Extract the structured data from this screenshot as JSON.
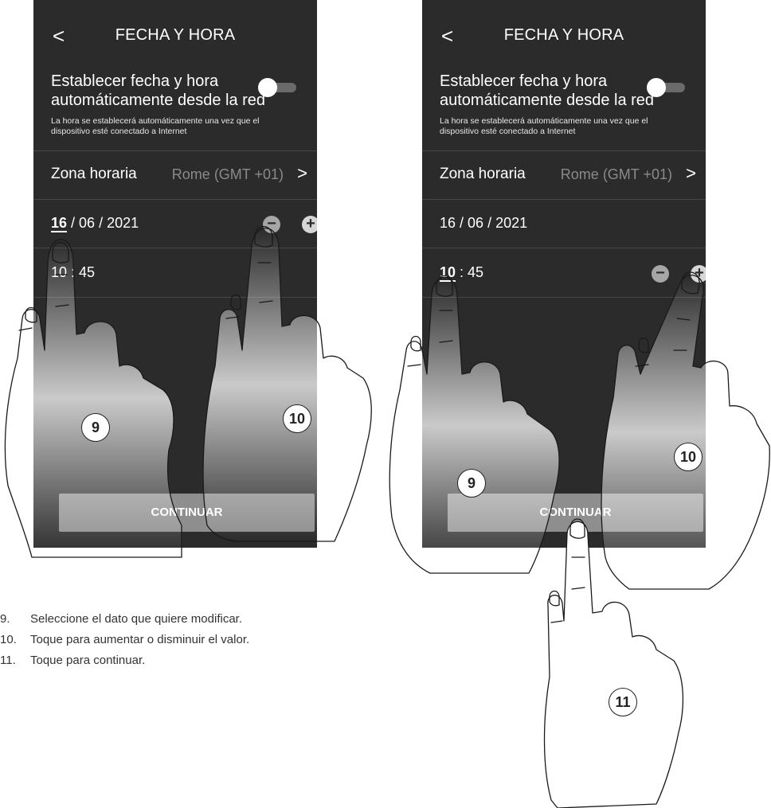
{
  "screens": [
    {
      "header": {
        "back_icon": "chevron-left",
        "title": "FECHA Y HORA"
      },
      "auto_time": {
        "label": "Establecer fecha y hora automáticamente desde la red",
        "description": "La hora se establecerá automáticamente una vez que el dispositivo esté conectado a Internet",
        "enabled": false
      },
      "timezone": {
        "label": "Zona horaria",
        "value": "Rome (GMT +01)",
        "chevron_icon": "chevron-right"
      },
      "date": {
        "day": "16",
        "month": "06",
        "year": "2021",
        "sep": " / ",
        "selected": "day"
      },
      "time": {
        "hour": "10",
        "minute": "45",
        "sep": " : "
      },
      "continue_label": "CONTINUAR"
    },
    {
      "header": {
        "back_icon": "chevron-left",
        "title": "FECHA Y HORA"
      },
      "auto_time": {
        "label": "Establecer fecha y hora automáticamente desde la red",
        "description": "La hora se establecerá automáticamente una vez que el dispositivo esté conectado a Internet",
        "enabled": false
      },
      "timezone": {
        "label": "Zona horaria",
        "value": "Rome (GMT +01)",
        "chevron_icon": "chevron-right"
      },
      "date": {
        "day": "16",
        "month": "06",
        "year": "2021",
        "sep": " / "
      },
      "time": {
        "hour": "10",
        "minute": "45",
        "sep": " : ",
        "selected": "hour"
      },
      "continue_label": "CONTINUAR"
    }
  ],
  "controls": {
    "minus": "−",
    "plus": "+"
  },
  "callouts": [
    "9",
    "10",
    "11"
  ],
  "instructions": [
    {
      "num": "9.",
      "text": "Seleccione el dato que quiere modificar."
    },
    {
      "num": "10.",
      "text": "Toque para aumentar o disminuir el valor."
    },
    {
      "num": "11.",
      "text": "Toque para continuar."
    }
  ],
  "colors": {
    "screen_bg": "#2b2b2b",
    "button_bg": "#8e8e8e",
    "muted_text": "#8a8a8a"
  }
}
